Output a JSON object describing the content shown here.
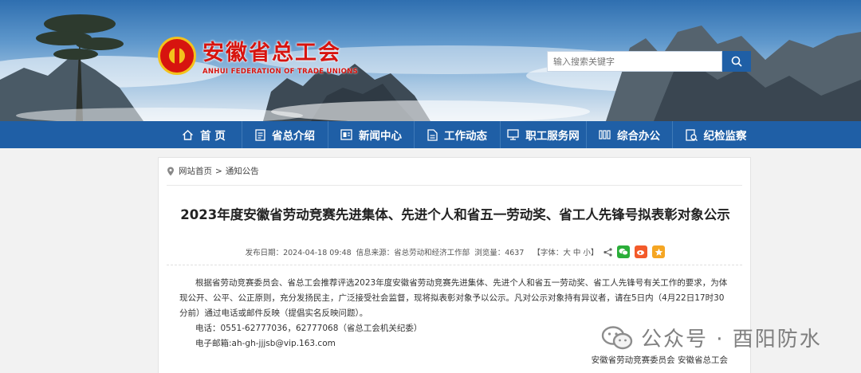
{
  "header": {
    "logo_cn": "安徽省总工会",
    "logo_en": "ANHUI FEDERATION OF TRADE UNIONS",
    "search_placeholder": "输入搜索关键字"
  },
  "nav": [
    {
      "label": "首 页",
      "icon": "home-icon"
    },
    {
      "label": "省总介绍",
      "icon": "document-icon"
    },
    {
      "label": "新闻中心",
      "icon": "news-icon"
    },
    {
      "label": "工作动态",
      "icon": "file-icon"
    },
    {
      "label": "职工服务网",
      "icon": "monitor-icon"
    },
    {
      "label": "综合办公",
      "icon": "columns-icon"
    },
    {
      "label": "纪检监察",
      "icon": "inspect-icon"
    }
  ],
  "breadcrumb": {
    "home": "网站首页",
    "sep": ">",
    "current": "通知公告"
  },
  "article": {
    "title": "2023年度安徽省劳动竞赛先进集体、先进个人和省五一劳动奖、省工人先锋号拟表彰对象公示",
    "publish_date": "发布日期：2024-04-18 09:48",
    "source": "信息来源：省总劳动和经济工作部",
    "views": "浏览量：4637",
    "font_size_label": "【字体：大 中 小】",
    "paragraph": "根据省劳动竞赛委员会、省总工会推荐评选2023年度安徽省劳动竞赛先进集体、先进个人和省五一劳动奖、省工人先锋号有关工作的要求，为体现公开、公平、公正原则，充分发扬民主，广泛接受社会监督，现将拟表彰对象予以公示。凡对公示对象持有异议者，请在5日内（4月22日17时30分前）通过电话或邮件反映（提倡实名反映问题）。",
    "phone": "电话：0551-62777036，62777068（省总工会机关纪委）",
    "email": "电子邮箱:ah-gh-jjjsb@vip.163.com",
    "signature": "安徽省劳动竞赛委员会  安徽省总工会"
  },
  "watermark": {
    "text": "公众号 · 酉阳防水"
  },
  "colors": {
    "nav_bg": "#1f5fa6",
    "brand_red": "#d7140f",
    "wechat_green": "#2aae39",
    "weibo_orange": "#f35a2a",
    "star_orange": "#f5a623"
  }
}
